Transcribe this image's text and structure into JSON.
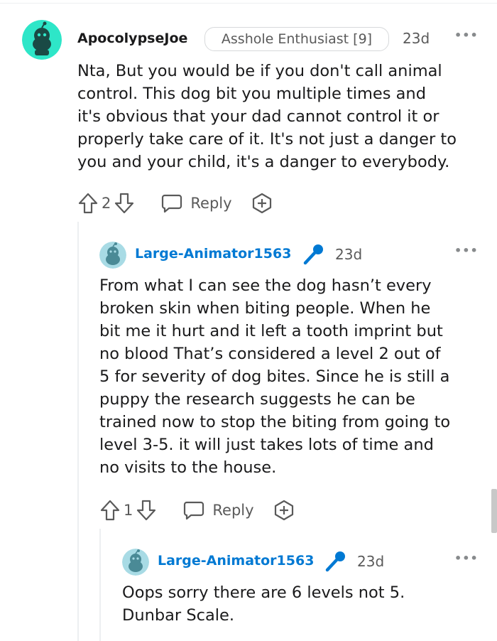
{
  "comments": [
    {
      "username": "ApocolypseJoe",
      "flair": "Asshole Enthusiast [9]",
      "time": "23d",
      "body": [
        "Nta, But you would be if you don't call animal",
        "control. This dog bit you multiple times and",
        "it's obvious that your dad cannot control it or",
        "properly take care of it. It's not just a danger to",
        "you and your child, it's a danger to everybody."
      ],
      "votes": "2",
      "reply_label": "Reply"
    },
    {
      "username": "Large-Animator1563",
      "is_op": true,
      "time": "23d",
      "body": [
        "From what I can see the dog hasn’t every",
        "broken skin when biting people. When he",
        "bit me it hurt and it left a tooth imprint but",
        "no blood That’s considered a level 2 out of",
        "5 for severity of dog bites. Since he is still a",
        "puppy the research suggests he can be",
        "trained now to stop the biting from going to",
        "level 3-5. it will just takes lots of time and",
        "no visits to the house."
      ],
      "votes": "1",
      "reply_label": "Reply"
    },
    {
      "username": "Large-Animator1563",
      "is_op": true,
      "time": "23d",
      "body": [
        "Oops sorry there are 6 levels not 5.",
        "Dunbar Scale."
      ]
    }
  ],
  "more_label": "•••",
  "colors": {
    "op_username": "#0079d3",
    "avatar_teal": "#2ee6c8",
    "avatar_light": "#a8dbe5",
    "mic_blue": "#0079d3",
    "thread_line": "#edeff1",
    "meta_gray": "#5a5a5a"
  },
  "icons": [
    "avatar-snoo-icon",
    "microphone-icon",
    "upvote-icon",
    "downvote-icon",
    "reply-bubble-icon",
    "add-award-icon",
    "more-options-icon"
  ]
}
